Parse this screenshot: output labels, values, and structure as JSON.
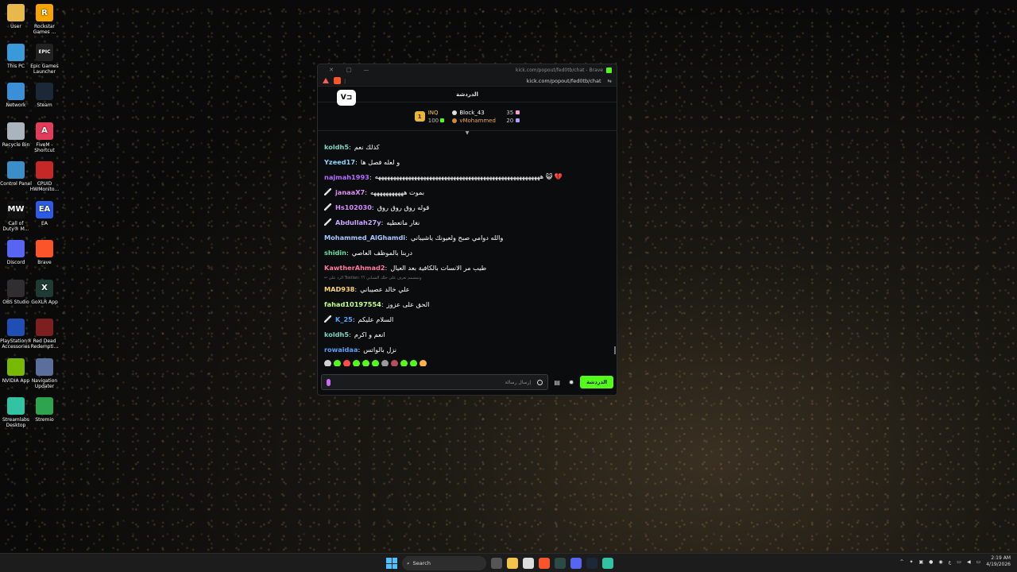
{
  "desktop": {
    "icons": [
      {
        "label": "User",
        "color": "#e8b84a",
        "glyph": ""
      },
      {
        "label": "Rockstar Games ...",
        "color": "#f5a400",
        "glyph": "R"
      },
      {
        "label": "This PC",
        "color": "#3a9ad9",
        "glyph": ""
      },
      {
        "label": "Epic Games Launcher",
        "color": "#222222",
        "glyph": "EPIC"
      },
      {
        "label": "Network",
        "color": "#3b8fd6",
        "glyph": ""
      },
      {
        "label": "Steam",
        "color": "#1b2838",
        "glyph": ""
      },
      {
        "label": "Recycle Bin",
        "color": "#aab4bd",
        "glyph": ""
      },
      {
        "label": "FiveM - Shortcut",
        "color": "#e33b5a",
        "glyph": "A"
      },
      {
        "label": "Control Panel",
        "color": "#3a8fc9",
        "glyph": ""
      },
      {
        "label": "CPUID HWMonito...",
        "color": "#c62828",
        "glyph": ""
      },
      {
        "label": "Call of Duty® M...",
        "color": "#111111",
        "glyph": "MW"
      },
      {
        "label": "EA",
        "color": "#2b5ce6",
        "glyph": "EA"
      },
      {
        "label": "Discord",
        "color": "#5865f2",
        "glyph": ""
      },
      {
        "label": "Brave",
        "color": "#fb542b",
        "glyph": ""
      },
      {
        "label": "OBS Studio",
        "color": "#302e31",
        "glyph": ""
      },
      {
        "label": "GoXLR App",
        "color": "#1f3a33",
        "glyph": "X"
      },
      {
        "label": "PlayStation® Accessories",
        "color": "#1f4fb5",
        "glyph": ""
      },
      {
        "label": "Red Dead Redempti...",
        "color": "#7d1f1f",
        "glyph": ""
      },
      {
        "label": "NVIDIA App",
        "color": "#76b900",
        "glyph": ""
      },
      {
        "label": "Navigation Updater",
        "color": "#5a6f9b",
        "glyph": ""
      },
      {
        "label": "Streamlabs Desktop",
        "color": "#31c3a2",
        "glyph": ""
      },
      {
        "label": "Stremio",
        "color": "#2ea44f",
        "glyph": ""
      }
    ]
  },
  "window": {
    "title": "kick.com/popout/fed0tb/chat - Brave",
    "url": "kick.com/popout/fed0tb/chat",
    "chat_title": "الدردشة",
    "logo_text": "V⊐"
  },
  "leaderboard": {
    "rank": "1",
    "top_name": "INQ",
    "top_points": "100",
    "entries": [
      {
        "name": "Block_43",
        "points": "35"
      },
      {
        "name": "vMohammed",
        "points": "20"
      }
    ]
  },
  "messages": [
    {
      "user": "koldh5",
      "color": "#7ad4c2",
      "text": "كذلك نعم",
      "badge": false
    },
    {
      "user": "Yzeed17",
      "color": "#8fd3ff",
      "text": "و لعله فصل ها",
      "badge": false
    },
    {
      "user": "najmah1993",
      "color": "#b46cff",
      "text": "هههههههههههههههههههههههههههههههههههههههههههههههههههههههه 😺 💔",
      "badge": false
    },
    {
      "user": "janaaX7",
      "color": "#e08cf5",
      "text": "بموت هههههههههههه",
      "badge": true
    },
    {
      "user": "Hs102030",
      "color": "#d58cff",
      "text": "قوله روق روق روق",
      "badge": true
    },
    {
      "user": "Abdullah27y",
      "color": "#c9a8ff",
      "text": "نغار ماتعطيه",
      "badge": true
    },
    {
      "user": "Mohammed_AlGhamdi",
      "color": "#a8c8ff",
      "text": "والله دوامي صبح ولعيونك ياشيباني",
      "badge": false
    },
    {
      "user": "shidin",
      "color": "#5fe0a0",
      "text": "دربنا بالموظف العاصي",
      "badge": false
    },
    {
      "user": "KawtherAhmad2",
      "color": "#ff7a9c",
      "text": "طيب مر الانسات بالكافية بعد العيال",
      "badge": false
    },
    {
      "user": "MAD938",
      "color": "#ffd36e",
      "text": "علي خالد عصيباني",
      "badge": false,
      "reply": "الرد على Tostlan: وتمسمم تعرف على حلك الشبابي ؟؟"
    },
    {
      "user": "fahad10197554",
      "color": "#c6ff8c",
      "text": "الحق على عزوز",
      "badge": false
    },
    {
      "user": "K_25",
      "color": "#4fa8ff",
      "text": "السلام عليكم",
      "badge": true
    },
    {
      "user": "koldh5",
      "color": "#7ad4c2",
      "text": "انعم و اكرم",
      "badge": false
    },
    {
      "user": "rowaidaa",
      "color": "#5aa0ff",
      "text": "نزل بالواتس",
      "badge": false
    }
  ],
  "emote_colors": [
    "#d0d0d0",
    "#53fc18",
    "#ff4b4b",
    "#53fc18",
    "#53fc18",
    "#53fc18",
    "#9a9a9a",
    "#b0505a",
    "#53fc18",
    "#53fc18",
    "#ffb347"
  ],
  "input": {
    "placeholder": "إرسال رسالة",
    "send_label": "الدردشة"
  },
  "taskbar": {
    "search_label": "Search",
    "time": "2:19 AM",
    "date": "4/19/2026",
    "lang": "ع"
  }
}
